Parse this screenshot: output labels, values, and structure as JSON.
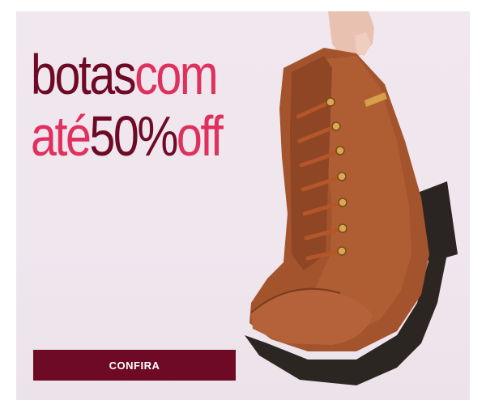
{
  "headline": {
    "line1_a": "botas",
    "line1_b": "com",
    "line2_a": "até",
    "line2_b": "50%",
    "line2_c": "off"
  },
  "cta": {
    "label": "CONFIRA"
  },
  "image": {
    "subject": "boot-with-hand-icon"
  },
  "colors": {
    "brand_dark": "#6e0a25",
    "brand_pink": "#e0305d",
    "background": "#efe6ee"
  }
}
